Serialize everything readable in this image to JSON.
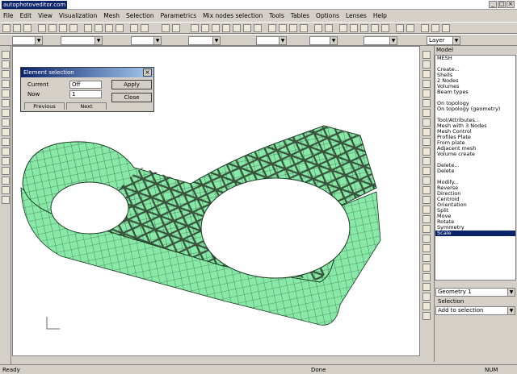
{
  "window": {
    "title": "autophotoveditor.com",
    "min": "_",
    "max": "□",
    "close": "×"
  },
  "menu": [
    "File",
    "Edit",
    "View",
    "Visualization",
    "Mesh",
    "Selection",
    "Parametrics",
    "Mix nodes selection",
    "Tools",
    "Tables",
    "Options",
    "Lenses",
    "Help"
  ],
  "combos": {
    "row2": [
      "",
      "",
      "",
      "",
      "",
      "",
      ""
    ],
    "layer": "Layer"
  },
  "dialog": {
    "title": "Element selection",
    "current_label": "Current",
    "current_value": "Off",
    "now_label": "Now",
    "now_value": "1",
    "apply": "Apply",
    "close": "Close",
    "tab1": "Previous",
    "tab2": "Next"
  },
  "panel": {
    "header": "Model",
    "tree": [
      {
        "text": "MESH"
      },
      {
        "text": ""
      },
      {
        "text": "Create..."
      },
      {
        "text": "  Shells"
      },
      {
        "text": "  2 Nodes"
      },
      {
        "text": "  Volumes"
      },
      {
        "text": "  Beam types"
      },
      {
        "text": ""
      },
      {
        "text": "  On topology"
      },
      {
        "text": "  On topology (geometry)"
      },
      {
        "text": ""
      },
      {
        "text": "Tool/Attributes..."
      },
      {
        "text": "  Mesh with 3 Nodes"
      },
      {
        "text": "  Mesh Control"
      },
      {
        "text": "  Profiles Plate"
      },
      {
        "text": "  From plate"
      },
      {
        "text": "  Adjacent mesh"
      },
      {
        "text": "  Volume create"
      },
      {
        "text": ""
      },
      {
        "text": "Delete..."
      },
      {
        "text": "  Delete"
      },
      {
        "text": ""
      },
      {
        "text": "Modify..."
      },
      {
        "text": "  Reverse"
      },
      {
        "text": "  Direction"
      },
      {
        "text": "  Centroid"
      },
      {
        "text": "  Orientation"
      },
      {
        "text": "  Split"
      },
      {
        "text": "  Move"
      },
      {
        "text": "  Rotate"
      },
      {
        "text": "  Symmetry"
      },
      {
        "text": "  Scale",
        "selected": true
      }
    ],
    "bottom_combo": "Geometry 1",
    "selection_label": "Selection",
    "selection_combo": "Add to selection"
  },
  "status": {
    "left": "Ready",
    "mid": "Done",
    "num": "NUM"
  },
  "colors": {
    "mesh_fill": "#88e8a8",
    "mesh_line": "#1a3a22",
    "selection": "#0a246a",
    "background": "#d4d0c8"
  }
}
